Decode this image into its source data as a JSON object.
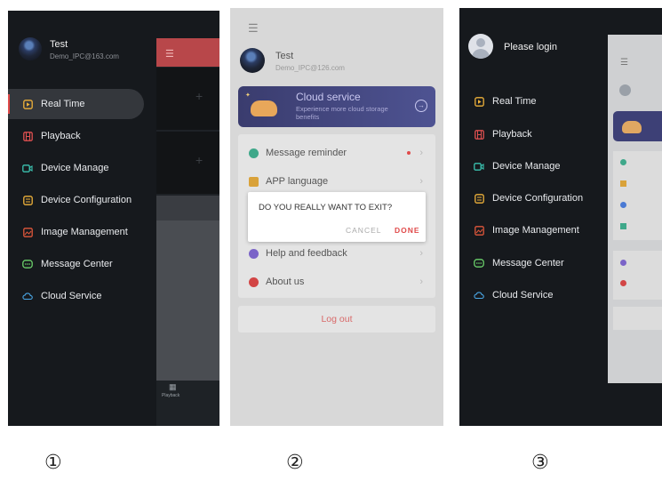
{
  "screen1": {
    "user_name": "Test",
    "user_email": "Demo_IPC@163.com",
    "menu": [
      {
        "label": "Real Time",
        "icon": "play-icon"
      },
      {
        "label": "Playback",
        "icon": "film-icon"
      },
      {
        "label": "Device Manage",
        "icon": "camera-icon"
      },
      {
        "label": "Device Configuration",
        "icon": "config-icon"
      },
      {
        "label": "Image Management",
        "icon": "image-icon"
      },
      {
        "label": "Message Center",
        "icon": "message-icon"
      },
      {
        "label": "Cloud Service",
        "icon": "cloud-icon"
      }
    ],
    "bg_tab_label": "Playback",
    "accent": "#e04a4a"
  },
  "screen2": {
    "user_name": "Test",
    "user_email": "Demo_IPC@126.com",
    "cloud_title": "Cloud service",
    "cloud_desc": "Experience more cloud storage benefits",
    "items": [
      {
        "label": "Message reminder",
        "color": "#3fa88a"
      },
      {
        "label": "APP language",
        "color": "#d9a23a"
      }
    ],
    "items2": [
      {
        "label": "Help and feedback",
        "color": "#7b64c8"
      },
      {
        "label": "About us",
        "color": "#d24545"
      }
    ],
    "dialog": {
      "message": "DO YOU REALLY WANT TO EXIT?",
      "cancel": "CANCEL",
      "done": "DONE"
    },
    "logout": "Log out"
  },
  "screen3": {
    "login_label": "Please login",
    "menu": [
      {
        "label": "Real Time",
        "icon": "play-icon"
      },
      {
        "label": "Playback",
        "icon": "film-icon"
      },
      {
        "label": "Device Manage",
        "icon": "camera-icon"
      },
      {
        "label": "Device Configuration",
        "icon": "config-icon"
      },
      {
        "label": "Image Management",
        "icon": "image-icon"
      },
      {
        "label": "Message Center",
        "icon": "message-icon"
      },
      {
        "label": "Cloud Service",
        "icon": "cloud-icon"
      }
    ]
  },
  "captions": [
    "①",
    "②",
    "③"
  ]
}
